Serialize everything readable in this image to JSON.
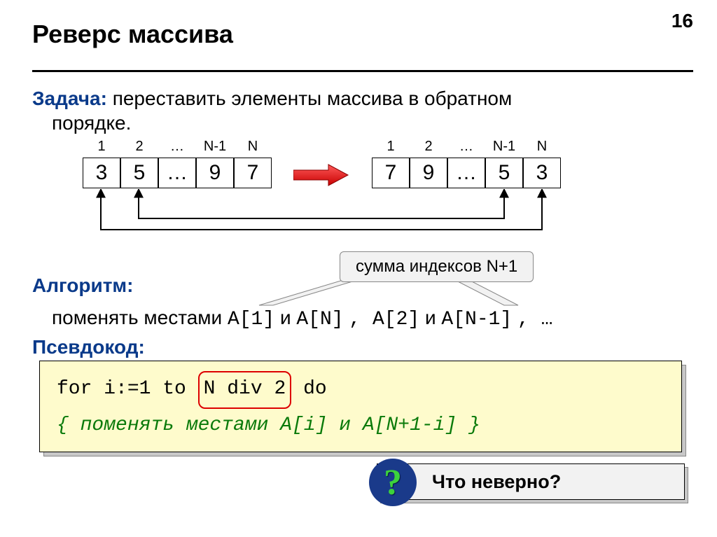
{
  "page_number": "16",
  "title": "Реверс массива",
  "task": {
    "label": "Задача:",
    "text1": " переставить элементы массива в обратном",
    "text2": "порядке."
  },
  "arrays": {
    "indices": [
      "1",
      "2",
      "…",
      "N-1",
      "N"
    ],
    "left": [
      "3",
      "5",
      "…",
      "9",
      "7"
    ],
    "right": [
      "7",
      "9",
      "…",
      "5",
      "3"
    ]
  },
  "callout": "сумма индексов N+1",
  "algorithm": {
    "label": "Алгоритм:",
    "text_before": "поменять местами ",
    "pair1a": "A[1]",
    "and": " и ",
    "pair1b": "A[N]",
    "sep": ", ",
    "pair2a": "A[2]",
    "pair2b": "A[N-1]",
    "tail": ", …"
  },
  "pseudocode": {
    "label": "Псевдокод:",
    "line1_a": "for i:=1 to ",
    "line1_hl": "N div 2",
    "line1_b": " do",
    "line2": " { поменять местами A[i] и A[N+1-i] }"
  },
  "question": "Что неверно?",
  "question_mark": "?"
}
